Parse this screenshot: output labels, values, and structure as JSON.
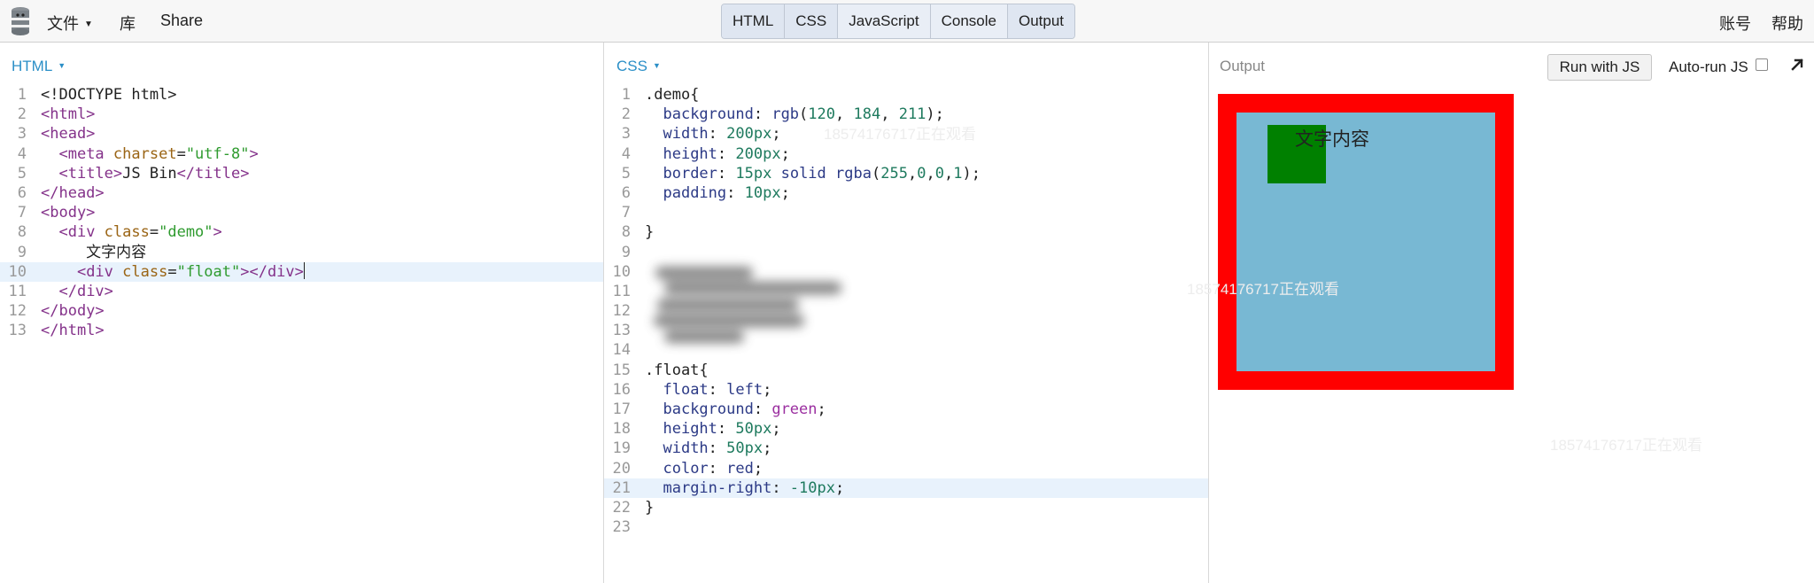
{
  "topbar": {
    "menu": [
      {
        "label": "文件",
        "has_caret": true
      },
      {
        "label": "库",
        "has_caret": false
      },
      {
        "label": "Share",
        "has_caret": false
      }
    ],
    "tabs": [
      {
        "label": "HTML",
        "active": true
      },
      {
        "label": "CSS",
        "active": true
      },
      {
        "label": "JavaScript",
        "active": false
      },
      {
        "label": "Console",
        "active": false
      },
      {
        "label": "Output",
        "active": true
      }
    ],
    "right": [
      {
        "label": "账号"
      },
      {
        "label": "帮助"
      }
    ]
  },
  "html_panel": {
    "title": "HTML",
    "active_line": 10,
    "lines": [
      {
        "n": "1",
        "segs": [
          [
            "pl",
            "<!DOCTYPE html>"
          ]
        ]
      },
      {
        "n": "2",
        "segs": [
          [
            "tg",
            "<html>"
          ]
        ]
      },
      {
        "n": "3",
        "segs": [
          [
            "tg",
            "<head>"
          ]
        ]
      },
      {
        "n": "4",
        "segs": [
          [
            "pl",
            "  "
          ],
          [
            "tg",
            "<meta "
          ],
          [
            "at",
            "charset"
          ],
          [
            "pl",
            "="
          ],
          [
            "st",
            "\"utf-8\""
          ],
          [
            "tg",
            ">"
          ]
        ]
      },
      {
        "n": "5",
        "segs": [
          [
            "pl",
            "  "
          ],
          [
            "tg",
            "<title>"
          ],
          [
            "pl",
            "JS Bin"
          ],
          [
            "tg",
            "</title>"
          ]
        ]
      },
      {
        "n": "6",
        "segs": [
          [
            "tg",
            "</head>"
          ]
        ]
      },
      {
        "n": "7",
        "segs": [
          [
            "tg",
            "<body>"
          ]
        ]
      },
      {
        "n": "8",
        "segs": [
          [
            "pl",
            "  "
          ],
          [
            "tg",
            "<div "
          ],
          [
            "at",
            "class"
          ],
          [
            "pl",
            "="
          ],
          [
            "st",
            "\"demo\""
          ],
          [
            "tg",
            ">"
          ]
        ]
      },
      {
        "n": "9",
        "segs": [
          [
            "pl",
            "     文字内容"
          ]
        ]
      },
      {
        "n": "10",
        "segs": [
          [
            "pl",
            "    "
          ],
          [
            "tg",
            "<div "
          ],
          [
            "at",
            "class"
          ],
          [
            "pl",
            "="
          ],
          [
            "st",
            "\"float\""
          ],
          [
            "tg",
            "></div>"
          ]
        ]
      },
      {
        "n": "11",
        "segs": [
          [
            "pl",
            "  "
          ],
          [
            "tg",
            "</div>"
          ]
        ]
      },
      {
        "n": "12",
        "segs": [
          [
            "tg",
            "</body>"
          ]
        ]
      },
      {
        "n": "13",
        "segs": [
          [
            "tg",
            "</html>"
          ]
        ]
      }
    ]
  },
  "css_panel": {
    "title": "CSS",
    "active_line": 21,
    "lines": [
      {
        "n": "1",
        "segs": [
          [
            "pl",
            ".demo{"
          ]
        ]
      },
      {
        "n": "2",
        "segs": [
          [
            "pl",
            "  "
          ],
          [
            "pr",
            "background"
          ],
          [
            "pl",
            ": "
          ],
          [
            "pr",
            "rgb"
          ],
          [
            "pl",
            "("
          ],
          [
            "nm",
            "120"
          ],
          [
            "pl",
            ", "
          ],
          [
            "nm",
            "184"
          ],
          [
            "pl",
            ", "
          ],
          [
            "nm",
            "211"
          ],
          [
            "pl",
            ");"
          ]
        ]
      },
      {
        "n": "3",
        "segs": [
          [
            "pl",
            "  "
          ],
          [
            "pr",
            "width"
          ],
          [
            "pl",
            ": "
          ],
          [
            "nm",
            "200px"
          ],
          [
            "pl",
            ";"
          ]
        ]
      },
      {
        "n": "4",
        "segs": [
          [
            "pl",
            "  "
          ],
          [
            "pr",
            "height"
          ],
          [
            "pl",
            ": "
          ],
          [
            "nm",
            "200px"
          ],
          [
            "pl",
            ";"
          ]
        ]
      },
      {
        "n": "5",
        "segs": [
          [
            "pl",
            "  "
          ],
          [
            "pr",
            "border"
          ],
          [
            "pl",
            ": "
          ],
          [
            "nm",
            "15px"
          ],
          [
            "pl",
            " "
          ],
          [
            "pr",
            "solid"
          ],
          [
            "pl",
            " "
          ],
          [
            "pr",
            "rgba"
          ],
          [
            "pl",
            "("
          ],
          [
            "nm",
            "255"
          ],
          [
            "pl",
            ","
          ],
          [
            "nm",
            "0"
          ],
          [
            "pl",
            ","
          ],
          [
            "nm",
            "0"
          ],
          [
            "pl",
            ","
          ],
          [
            "nm",
            "1"
          ],
          [
            "pl",
            ");"
          ]
        ]
      },
      {
        "n": "6",
        "segs": [
          [
            "pl",
            "  "
          ],
          [
            "pr",
            "padding"
          ],
          [
            "pl",
            ": "
          ],
          [
            "nm",
            "10px"
          ],
          [
            "pl",
            ";"
          ]
        ]
      },
      {
        "n": "7",
        "segs": []
      },
      {
        "n": "8",
        "segs": [
          [
            "pl",
            "}"
          ]
        ]
      },
      {
        "n": "9",
        "segs": []
      },
      {
        "n": "10",
        "segs": []
      },
      {
        "n": "11",
        "segs": []
      },
      {
        "n": "12",
        "segs": []
      },
      {
        "n": "13",
        "segs": []
      },
      {
        "n": "14",
        "segs": []
      },
      {
        "n": "15",
        "segs": [
          [
            "pl",
            ".float{"
          ]
        ]
      },
      {
        "n": "16",
        "segs": [
          [
            "pl",
            "  "
          ],
          [
            "pr",
            "float"
          ],
          [
            "pl",
            ": "
          ],
          [
            "pr",
            "left"
          ],
          [
            "pl",
            ";"
          ]
        ]
      },
      {
        "n": "17",
        "segs": [
          [
            "pl",
            "  "
          ],
          [
            "pr",
            "background"
          ],
          [
            "pl",
            ": "
          ],
          [
            "kw",
            "green"
          ],
          [
            "pl",
            ";"
          ]
        ]
      },
      {
        "n": "18",
        "segs": [
          [
            "pl",
            "  "
          ],
          [
            "pr",
            "height"
          ],
          [
            "pl",
            ": "
          ],
          [
            "nm",
            "50px"
          ],
          [
            "pl",
            ";"
          ]
        ]
      },
      {
        "n": "19",
        "segs": [
          [
            "pl",
            "  "
          ],
          [
            "pr",
            "width"
          ],
          [
            "pl",
            ": "
          ],
          [
            "nm",
            "50px"
          ],
          [
            "pl",
            ";"
          ]
        ]
      },
      {
        "n": "20",
        "segs": [
          [
            "pl",
            "  "
          ],
          [
            "pr",
            "color"
          ],
          [
            "pl",
            ": "
          ],
          [
            "pr",
            "red"
          ],
          [
            "pl",
            ";"
          ]
        ]
      },
      {
        "n": "21",
        "segs": [
          [
            "pl",
            "  "
          ],
          [
            "pr",
            "margin-right"
          ],
          [
            "pl",
            ": "
          ],
          [
            "nm",
            "-10px"
          ],
          [
            "pl",
            ";"
          ]
        ]
      },
      {
        "n": "22",
        "segs": [
          [
            "pl",
            "}"
          ]
        ]
      },
      {
        "n": "23",
        "segs": []
      }
    ]
  },
  "output_panel": {
    "title": "Output",
    "run_button": "Run with JS",
    "autorun_label": "Auto-run JS",
    "autorun_checked": false,
    "demo_text": "文字内容"
  },
  "watermark": "18574176717正在观看",
  "colors": {
    "accent": "#2b8fc7",
    "demo_background": "rgb(120,184,211)",
    "demo_border": "#ff0000",
    "float_background": "#008000"
  }
}
